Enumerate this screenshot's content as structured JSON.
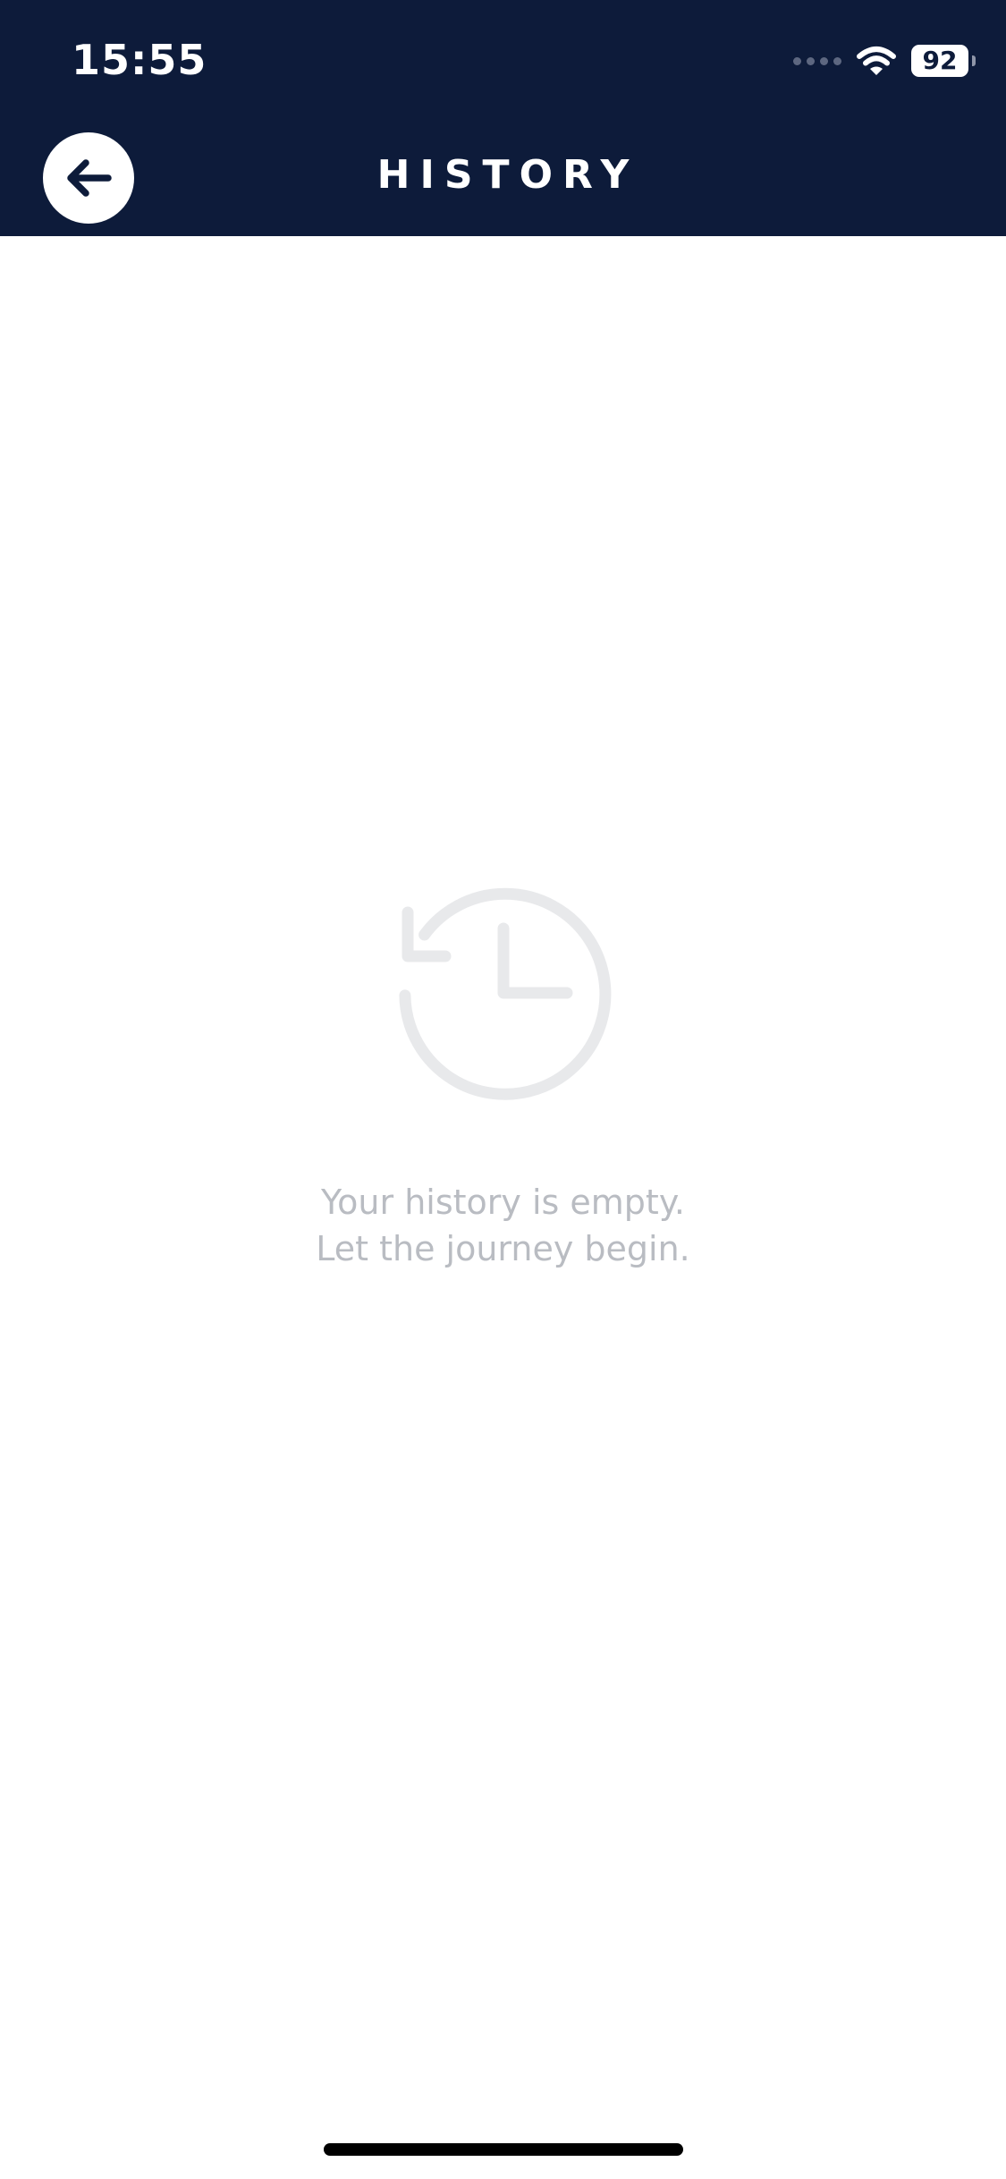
{
  "status_bar": {
    "time": "15:55",
    "battery_level": "92",
    "icons": [
      "cellular-signal-icon",
      "wifi-icon",
      "battery-icon"
    ]
  },
  "header": {
    "title": "HISTORY",
    "back_icon": "arrow-left-icon"
  },
  "empty_state": {
    "icon": "history-clock-icon",
    "line1": "Your history is empty.",
    "line2": "Let the journey begin."
  },
  "colors": {
    "header_background": "#0d1b3a",
    "empty_text": "#b9bcc2",
    "icon_gray": "#e8e9eb"
  }
}
